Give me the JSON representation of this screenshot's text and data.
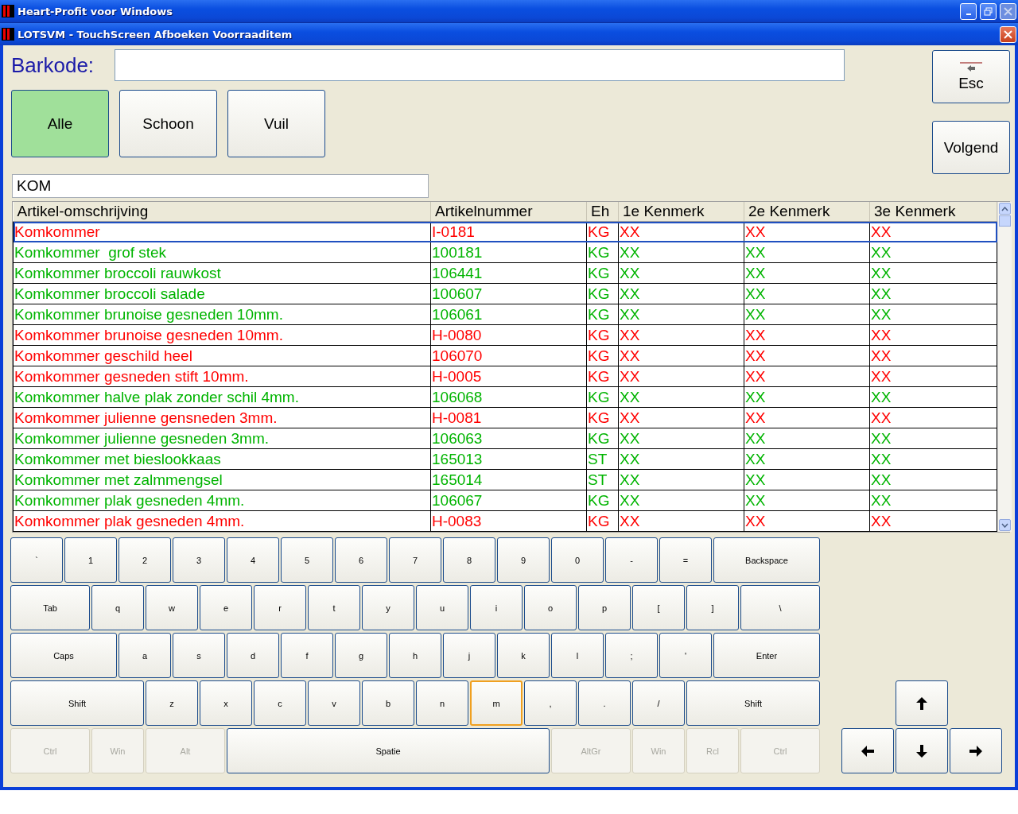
{
  "window": {
    "title": "Heart-Profit voor Windows"
  },
  "dialog": {
    "title": "LOTSVM - TouchScreen Afboeken Voorraaditem"
  },
  "barcode": {
    "label": "Barkode:"
  },
  "filters": [
    {
      "label": "Alle",
      "selected": true
    },
    {
      "label": "Schoon",
      "selected": false
    },
    {
      "label": "Vuil",
      "selected": false
    }
  ],
  "side_buttons": [
    {
      "label": "Esc",
      "kind": "escape"
    },
    {
      "label": "Volgend",
      "kind": "plain"
    }
  ],
  "search": {
    "value": "KOM"
  },
  "table": {
    "columns": [
      "Artikel-omschrijving",
      "Artikelnummer",
      "Eh",
      "1e Kenmerk",
      "2e Kenmerk",
      "3e Kenmerk"
    ],
    "rows": [
      {
        "cells": [
          "Komkommer",
          "I-0181",
          "KG",
          "XX",
          "XX",
          "XX"
        ],
        "color": "#ff0000",
        "selected": true
      },
      {
        "cells": [
          "Komkommer  grof stek",
          "100181",
          "KG",
          "XX",
          "XX",
          "XX"
        ],
        "color": "#00b400",
        "selected": false
      },
      {
        "cells": [
          "Komkommer broccoli rauwkost",
          "106441",
          "KG",
          "XX",
          "XX",
          "XX"
        ],
        "color": "#00b400",
        "selected": false
      },
      {
        "cells": [
          "Komkommer broccoli salade",
          "100607",
          "KG",
          "XX",
          "XX",
          "XX"
        ],
        "color": "#00b400",
        "selected": false
      },
      {
        "cells": [
          "Komkommer brunoise gesneden 10mm.",
          "106061",
          "KG",
          "XX",
          "XX",
          "XX"
        ],
        "color": "#00b400",
        "selected": false
      },
      {
        "cells": [
          "Komkommer brunoise gesneden 10mm.",
          "H-0080",
          "KG",
          "XX",
          "XX",
          "XX"
        ],
        "color": "#ff0000",
        "selected": false
      },
      {
        "cells": [
          "Komkommer geschild heel",
          "106070",
          "KG",
          "XX",
          "XX",
          "XX"
        ],
        "color": "#ff0000",
        "selected": false
      },
      {
        "cells": [
          "Komkommer gesneden stift 10mm.",
          "H-0005",
          "KG",
          "XX",
          "XX",
          "XX"
        ],
        "color": "#ff0000",
        "selected": false
      },
      {
        "cells": [
          "Komkommer halve plak zonder schil 4mm.",
          "106068",
          "KG",
          "XX",
          "XX",
          "XX"
        ],
        "color": "#00b400",
        "selected": false
      },
      {
        "cells": [
          "Komkommer julienne gensneden 3mm.",
          "H-0081",
          "KG",
          "XX",
          "XX",
          "XX"
        ],
        "color": "#ff0000",
        "selected": false
      },
      {
        "cells": [
          "Komkommer julienne gesneden 3mm.",
          "106063",
          "KG",
          "XX",
          "XX",
          "XX"
        ],
        "color": "#00b400",
        "selected": false
      },
      {
        "cells": [
          "Komkommer met bieslookkaas",
          "165013",
          "ST",
          "XX",
          "XX",
          "XX"
        ],
        "color": "#00b400",
        "selected": false
      },
      {
        "cells": [
          "Komkommer met zalmmengsel",
          "165014",
          "ST",
          "XX",
          "XX",
          "XX"
        ],
        "color": "#00b400",
        "selected": false
      },
      {
        "cells": [
          "Komkommer plak gesneden 4mm.",
          "106067",
          "KG",
          "XX",
          "XX",
          "XX"
        ],
        "color": "#00b400",
        "selected": false
      },
      {
        "cells": [
          "Komkommer plak gesneden 4mm.",
          "H-0083",
          "KG",
          "XX",
          "XX",
          "XX"
        ],
        "color": "#ff0000",
        "selected": false
      }
    ]
  },
  "keyboard": {
    "rows": [
      {
        "keys": [
          {
            "label": "`",
            "disabled": false,
            "focused": false
          },
          {
            "label": "1",
            "disabled": false,
            "focused": false
          },
          {
            "label": "2",
            "disabled": false,
            "focused": false
          },
          {
            "label": "3",
            "disabled": false,
            "focused": false
          },
          {
            "label": "4",
            "disabled": false,
            "focused": false
          },
          {
            "label": "5",
            "disabled": false,
            "focused": false
          },
          {
            "label": "6",
            "disabled": false,
            "focused": false
          },
          {
            "label": "7",
            "disabled": false,
            "focused": false
          },
          {
            "label": "8",
            "disabled": false,
            "focused": false
          },
          {
            "label": "9",
            "disabled": false,
            "focused": false
          },
          {
            "label": "0",
            "disabled": false,
            "focused": false
          },
          {
            "label": "-",
            "disabled": false,
            "focused": false
          },
          {
            "label": "=",
            "disabled": false,
            "focused": false
          },
          {
            "label": "Backspace",
            "disabled": false,
            "focused": false
          }
        ]
      },
      {
        "keys": [
          {
            "label": "Tab",
            "disabled": false,
            "focused": false
          },
          {
            "label": "q",
            "disabled": false,
            "focused": false
          },
          {
            "label": "w",
            "disabled": false,
            "focused": false
          },
          {
            "label": "e",
            "disabled": false,
            "focused": false
          },
          {
            "label": "r",
            "disabled": false,
            "focused": false
          },
          {
            "label": "t",
            "disabled": false,
            "focused": false
          },
          {
            "label": "y",
            "disabled": false,
            "focused": false
          },
          {
            "label": "u",
            "disabled": false,
            "focused": false
          },
          {
            "label": "i",
            "disabled": false,
            "focused": false
          },
          {
            "label": "o",
            "disabled": false,
            "focused": false
          },
          {
            "label": "p",
            "disabled": false,
            "focused": false
          },
          {
            "label": "[",
            "disabled": false,
            "focused": false
          },
          {
            "label": "]",
            "disabled": false,
            "focused": false
          },
          {
            "label": "\\",
            "disabled": false,
            "focused": false
          }
        ]
      },
      {
        "keys": [
          {
            "label": "Caps",
            "disabled": false,
            "focused": false
          },
          {
            "label": "a",
            "disabled": false,
            "focused": false
          },
          {
            "label": "s",
            "disabled": false,
            "focused": false
          },
          {
            "label": "d",
            "disabled": false,
            "focused": false
          },
          {
            "label": "f",
            "disabled": false,
            "focused": false
          },
          {
            "label": "g",
            "disabled": false,
            "focused": false
          },
          {
            "label": "h",
            "disabled": false,
            "focused": false
          },
          {
            "label": "j",
            "disabled": false,
            "focused": false
          },
          {
            "label": "k",
            "disabled": false,
            "focused": false
          },
          {
            "label": "l",
            "disabled": false,
            "focused": false
          },
          {
            "label": ";",
            "disabled": false,
            "focused": false
          },
          {
            "label": "'",
            "disabled": false,
            "focused": false
          },
          {
            "label": "Enter",
            "disabled": false,
            "focused": false
          }
        ]
      },
      {
        "keys": [
          {
            "label": "Shift",
            "disabled": false,
            "focused": false
          },
          {
            "label": "z",
            "disabled": false,
            "focused": false
          },
          {
            "label": "x",
            "disabled": false,
            "focused": false
          },
          {
            "label": "c",
            "disabled": false,
            "focused": false
          },
          {
            "label": "v",
            "disabled": false,
            "focused": false
          },
          {
            "label": "b",
            "disabled": false,
            "focused": false
          },
          {
            "label": "n",
            "disabled": false,
            "focused": false
          },
          {
            "label": "m",
            "disabled": false,
            "focused": true
          },
          {
            "label": ",",
            "disabled": false,
            "focused": false
          },
          {
            "label": ".",
            "disabled": false,
            "focused": false
          },
          {
            "label": "/",
            "disabled": false,
            "focused": false
          },
          {
            "label": "Shift",
            "disabled": false,
            "focused": false
          }
        ]
      },
      {
        "keys": [
          {
            "label": "Ctrl",
            "disabled": true,
            "focused": false
          },
          {
            "label": "Win",
            "disabled": true,
            "focused": false
          },
          {
            "label": "Alt",
            "disabled": true,
            "focused": false
          },
          {
            "label": "Spatie",
            "disabled": false,
            "focused": false
          },
          {
            "label": "AltGr",
            "disabled": true,
            "focused": false
          },
          {
            "label": "Win",
            "disabled": true,
            "focused": false
          },
          {
            "label": "Rcl",
            "disabled": true,
            "focused": false
          },
          {
            "label": "Ctrl",
            "disabled": true,
            "focused": false
          }
        ]
      }
    ]
  },
  "arrow_keys": [
    {
      "kind": "up"
    },
    {
      "kind": "left"
    },
    {
      "kind": "down"
    },
    {
      "kind": "right"
    }
  ]
}
